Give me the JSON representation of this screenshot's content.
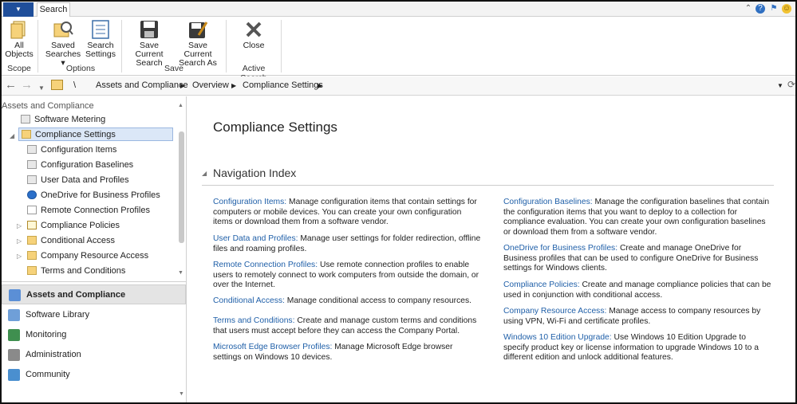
{
  "tabs": {
    "search": "Search"
  },
  "ribbon": {
    "buttons": {
      "all_objects": "All Objects",
      "saved_searches": "Saved Searches ▾",
      "search_settings": "Search Settings",
      "save_current_search": "Save Current Search",
      "save_current_search_as": "Save Current Search As",
      "close": "Close"
    },
    "groups": {
      "scope": "Scope",
      "options": "Options",
      "save": "Save",
      "active_search": "Active Search"
    }
  },
  "breadcrumb": {
    "root": "\\",
    "items": [
      "Assets and Compliance",
      "Overview",
      "Compliance Settings"
    ]
  },
  "left": {
    "header": "Assets and Compliance",
    "tree": [
      "Software Metering",
      "Compliance Settings",
      "Configuration Items",
      "Configuration Baselines",
      "User Data and Profiles",
      "OneDrive for Business Profiles",
      "Remote Connection Profiles",
      "Compliance Policies",
      "Conditional Access",
      "Company Resource Access",
      "Terms and Conditions"
    ],
    "workspaces": [
      "Assets and Compliance",
      "Software Library",
      "Monitoring",
      "Administration",
      "Community"
    ]
  },
  "content": {
    "title": "Compliance Settings",
    "nav_index": "Navigation Index",
    "left_col": [
      {
        "link": "Configuration Items:",
        "text": " Manage configuration items that contain settings for computers or mobile devices. You can create your own configuration items or download them from a software vendor."
      },
      {
        "link": "User Data and Profiles:",
        "text": " Manage user settings for folder redirection, offline files and roaming profiles."
      },
      {
        "link": "Remote Connection Profiles:",
        "text": " Use remote connection profiles to enable users to remotely connect to work computers from outside the domain, or over the Internet."
      },
      {
        "link": "Conditional Access:",
        "text": " Manage conditional access to company resources."
      },
      {
        "link": "Terms and Conditions:",
        "text": " Create and manage custom terms and conditions that users must accept before they can access the Company Portal."
      },
      {
        "link": "Microsoft Edge Browser Profiles:",
        "text": " Manage Microsoft Edge browser settings on Windows 10 devices."
      }
    ],
    "right_col": [
      {
        "link": "Configuration Baselines:",
        "text": " Manage the configuration baselines that contain the configuration items that you want to deploy to a collection for compliance evaluation. You can create your own configuration baselines or download them from a software vendor."
      },
      {
        "link": "OneDrive for Business Profiles:",
        "text": " Create and manage OneDrive for Business profiles that can be used to configure OneDrive for Business settings for Windows clients."
      },
      {
        "link": "Compliance Policies:",
        "text": " Create and manage compliance policies that can be used in conjunction with conditional access."
      },
      {
        "link": "Company Resource Access:",
        "text": " Manage access to company resources by using VPN, Wi-Fi and certificate profiles."
      },
      {
        "link": "Windows 10 Edition Upgrade:",
        "text": " Use Windows 10 Edition Upgrade to specify product key or license information to upgrade Windows 10 to a different edition and unlock additional features."
      }
    ]
  }
}
